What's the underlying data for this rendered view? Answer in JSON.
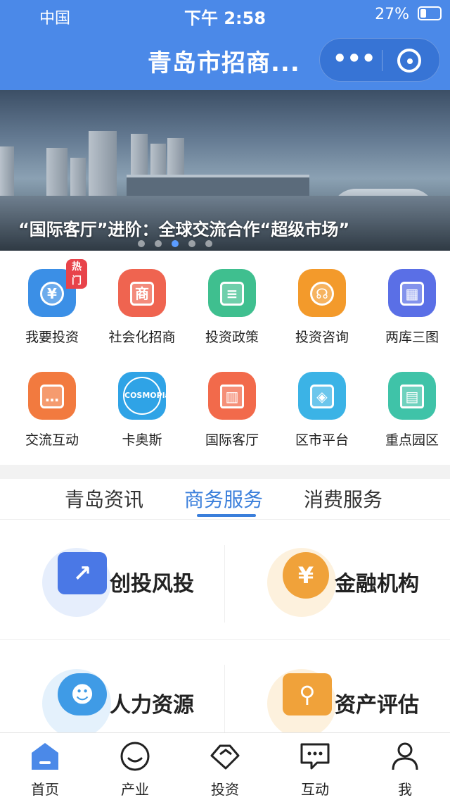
{
  "status_bar": {
    "carrier": "中国",
    "time": "下午 2:58",
    "battery": "27%"
  },
  "header": {
    "title": "青岛市招商..."
  },
  "banner": {
    "caption": "“国际客厅”进阶：全球交流合作“超级市场”"
  },
  "grid": [
    {
      "label": "我要投资",
      "badge": "热门",
      "icon": "yuan-icon",
      "color": "#3b8fe6",
      "glyph": "¥"
    },
    {
      "label": "社会化招商",
      "icon": "merchant-icon",
      "color": "#ef6450",
      "glyph": "商"
    },
    {
      "label": "投资政策",
      "icon": "policy-icon",
      "color": "#3fbf8f",
      "glyph": "≡"
    },
    {
      "label": "投资咨询",
      "icon": "headset-icon",
      "color": "#f39a2b",
      "glyph": "☊"
    },
    {
      "label": "两库三图",
      "icon": "grid-apps-icon",
      "color": "#5a6fe6",
      "glyph": "▦"
    },
    {
      "label": "交流互动",
      "icon": "chat-icon",
      "color": "#f27a3f",
      "glyph": "…"
    },
    {
      "label": "卡奥斯",
      "icon": "cosmoplat-icon",
      "color": "#2fa3e6",
      "glyph": "COSMOPlat"
    },
    {
      "label": "国际客厅",
      "icon": "building-icon",
      "color": "#f26a4b",
      "glyph": "▥"
    },
    {
      "label": "区市平台",
      "icon": "layers-icon",
      "color": "#3bb3e6",
      "glyph": "◈"
    },
    {
      "label": "重点园区",
      "icon": "park-icon",
      "color": "#3fc3a8",
      "glyph": "▤"
    }
  ],
  "tabs": [
    {
      "label": "青岛资讯"
    },
    {
      "label": "商务服务",
      "active": true
    },
    {
      "label": "消费服务"
    }
  ],
  "services": [
    {
      "label": "创投风投",
      "icon": "trend-chart-icon",
      "color": "#4a78e6",
      "bubble": "#e6eefc",
      "glyph": "↗"
    },
    {
      "label": "金融机构",
      "icon": "yuan-coin-icon",
      "color": "#f0a23a",
      "bubble": "#fdf1dd",
      "glyph": "¥"
    },
    {
      "label": "人力资源",
      "icon": "people-icon",
      "color": "#3f9be6",
      "bubble": "#e4f1fc",
      "glyph": "☻"
    },
    {
      "label": "资产评估",
      "icon": "search-document-icon",
      "color": "#f0a23a",
      "bubble": "#fdf1dd",
      "glyph": "⚲"
    }
  ],
  "bottom_nav": [
    {
      "label": "首页",
      "icon": "home-icon",
      "active": true
    },
    {
      "label": "产业",
      "icon": "smile-icon"
    },
    {
      "label": "投资",
      "icon": "handshake-icon"
    },
    {
      "label": "互动",
      "icon": "message-icon"
    },
    {
      "label": "我",
      "icon": "user-icon"
    }
  ],
  "colors": {
    "header": "#4b89e8",
    "accent": "#3b7fdb"
  }
}
